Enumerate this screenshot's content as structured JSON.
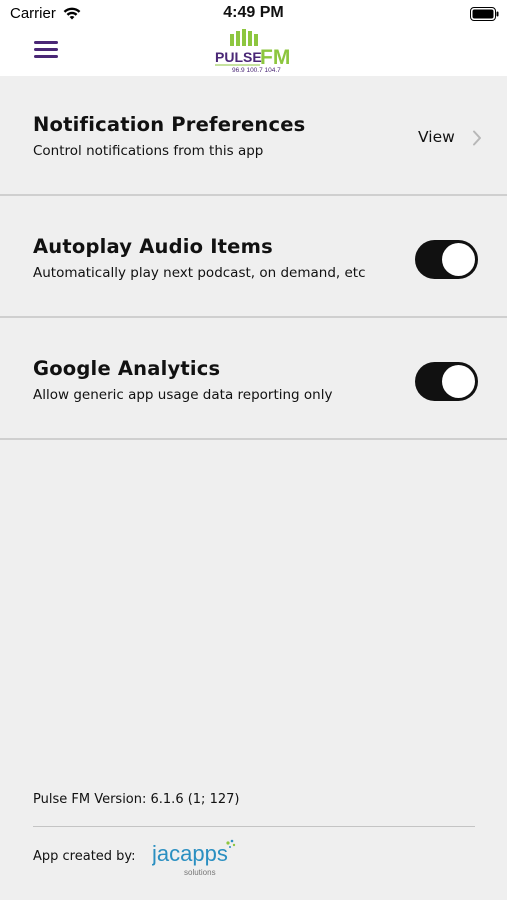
{
  "status_bar": {
    "carrier": "Carrier",
    "time": "4:49 PM"
  },
  "nav": {
    "menu_icon": "hamburger-icon",
    "logo": {
      "word1": "PULSE",
      "word2": "FM",
      "frequencies": "96.9  100.7  104.7",
      "color_purple": "#4a2776",
      "color_green": "#8dc63f"
    }
  },
  "settings": [
    {
      "title": "Notification Preferences",
      "subtitle": "Control notifications from this app",
      "action_label": "View",
      "control": "link"
    },
    {
      "title": "Autoplay Audio Items",
      "subtitle": "Automatically play next podcast, on demand, etc",
      "control": "toggle",
      "on": true
    },
    {
      "title": "Google Analytics",
      "subtitle": "Allow generic app usage data reporting only",
      "control": "toggle",
      "on": true
    }
  ],
  "footer": {
    "version_text": "Pulse FM Version: 6.1.6 (1; 127)",
    "created_by": "App created by:",
    "creator_logo": {
      "name": "jacapps",
      "tagline": "solutions",
      "color": "#2a8fc1"
    }
  }
}
